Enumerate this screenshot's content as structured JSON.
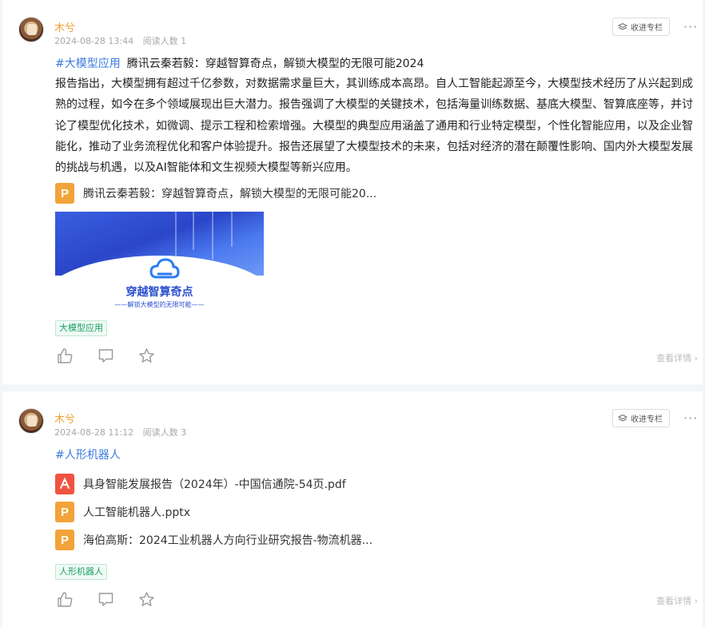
{
  "posts": [
    {
      "author": "木兮",
      "date": "2024-08-28 13:44",
      "views": "阅读人数 1",
      "collect_label": "收进专栏",
      "more": "···",
      "hashtag": "#大模型应用",
      "title": "腾讯云秦若毅：穿越智算奇点，解锁大模型的无限可能2024",
      "body": "报告指出，大模型拥有超过千亿参数，对数据需求量巨大，其训练成本高昂。自人工智能起源至今，大模型技术经历了从兴起到成熟的过程，如今在多个领域展现出巨大潜力。报告强调了大模型的关键技术，包括海量训练数据、基底大模型、智算底座等，并讨论了模型优化技术，如微调、提示工程和检索增强。大模型的典型应用涵盖了通用和行业特定模型，个性化智能应用，以及企业智能化，推动了业务流程优化和客户体验提升。报告还展望了大模型技术的未来，包括对经济的潜在颠覆性影响、国内外大模型发展的挑战与机遇，以及AI智能体和文生视频大模型等新兴应用。",
      "files": [
        {
          "type": "ppt",
          "icon": "P",
          "name": "腾讯云秦若毅：穿越智算奇点，解锁大模型的无限可能20..."
        }
      ],
      "thumbnail": {
        "title": "穿越智算奇点",
        "subtitle": "——解锁大模型的无限可能——"
      },
      "tag": "大模型应用",
      "detail_label": "查看详情 ›"
    },
    {
      "author": "木兮",
      "date": "2024-08-28 11:12",
      "views": "阅读人数 3",
      "collect_label": "收进专栏",
      "more": "···",
      "hashtag": "#人形机器人",
      "files": [
        {
          "type": "pdf",
          "icon": "✈",
          "name": "具身智能发展报告（2024年）-中国信通院-54页.pdf"
        },
        {
          "type": "ppt",
          "icon": "P",
          "name": "人工智能机器人.pptx"
        },
        {
          "type": "ppt",
          "icon": "P",
          "name": "海伯高斯：2024工业机器人方向行业研究报告-物流机器..."
        }
      ],
      "tag": "人形机器人",
      "detail_label": "查看详情 ›"
    }
  ],
  "colors": {
    "author": "#f0a030",
    "hashtag": "#3d7be0",
    "tag_text": "#19a164",
    "ppt_icon": "#f2a33a",
    "pdf_icon": "#f2533f"
  },
  "icons": [
    "avatar",
    "bookmark-icon",
    "more-icon",
    "ppt-file-icon",
    "pdf-file-icon",
    "like-icon",
    "comment-icon",
    "star-icon",
    "chevron-right-icon"
  ]
}
